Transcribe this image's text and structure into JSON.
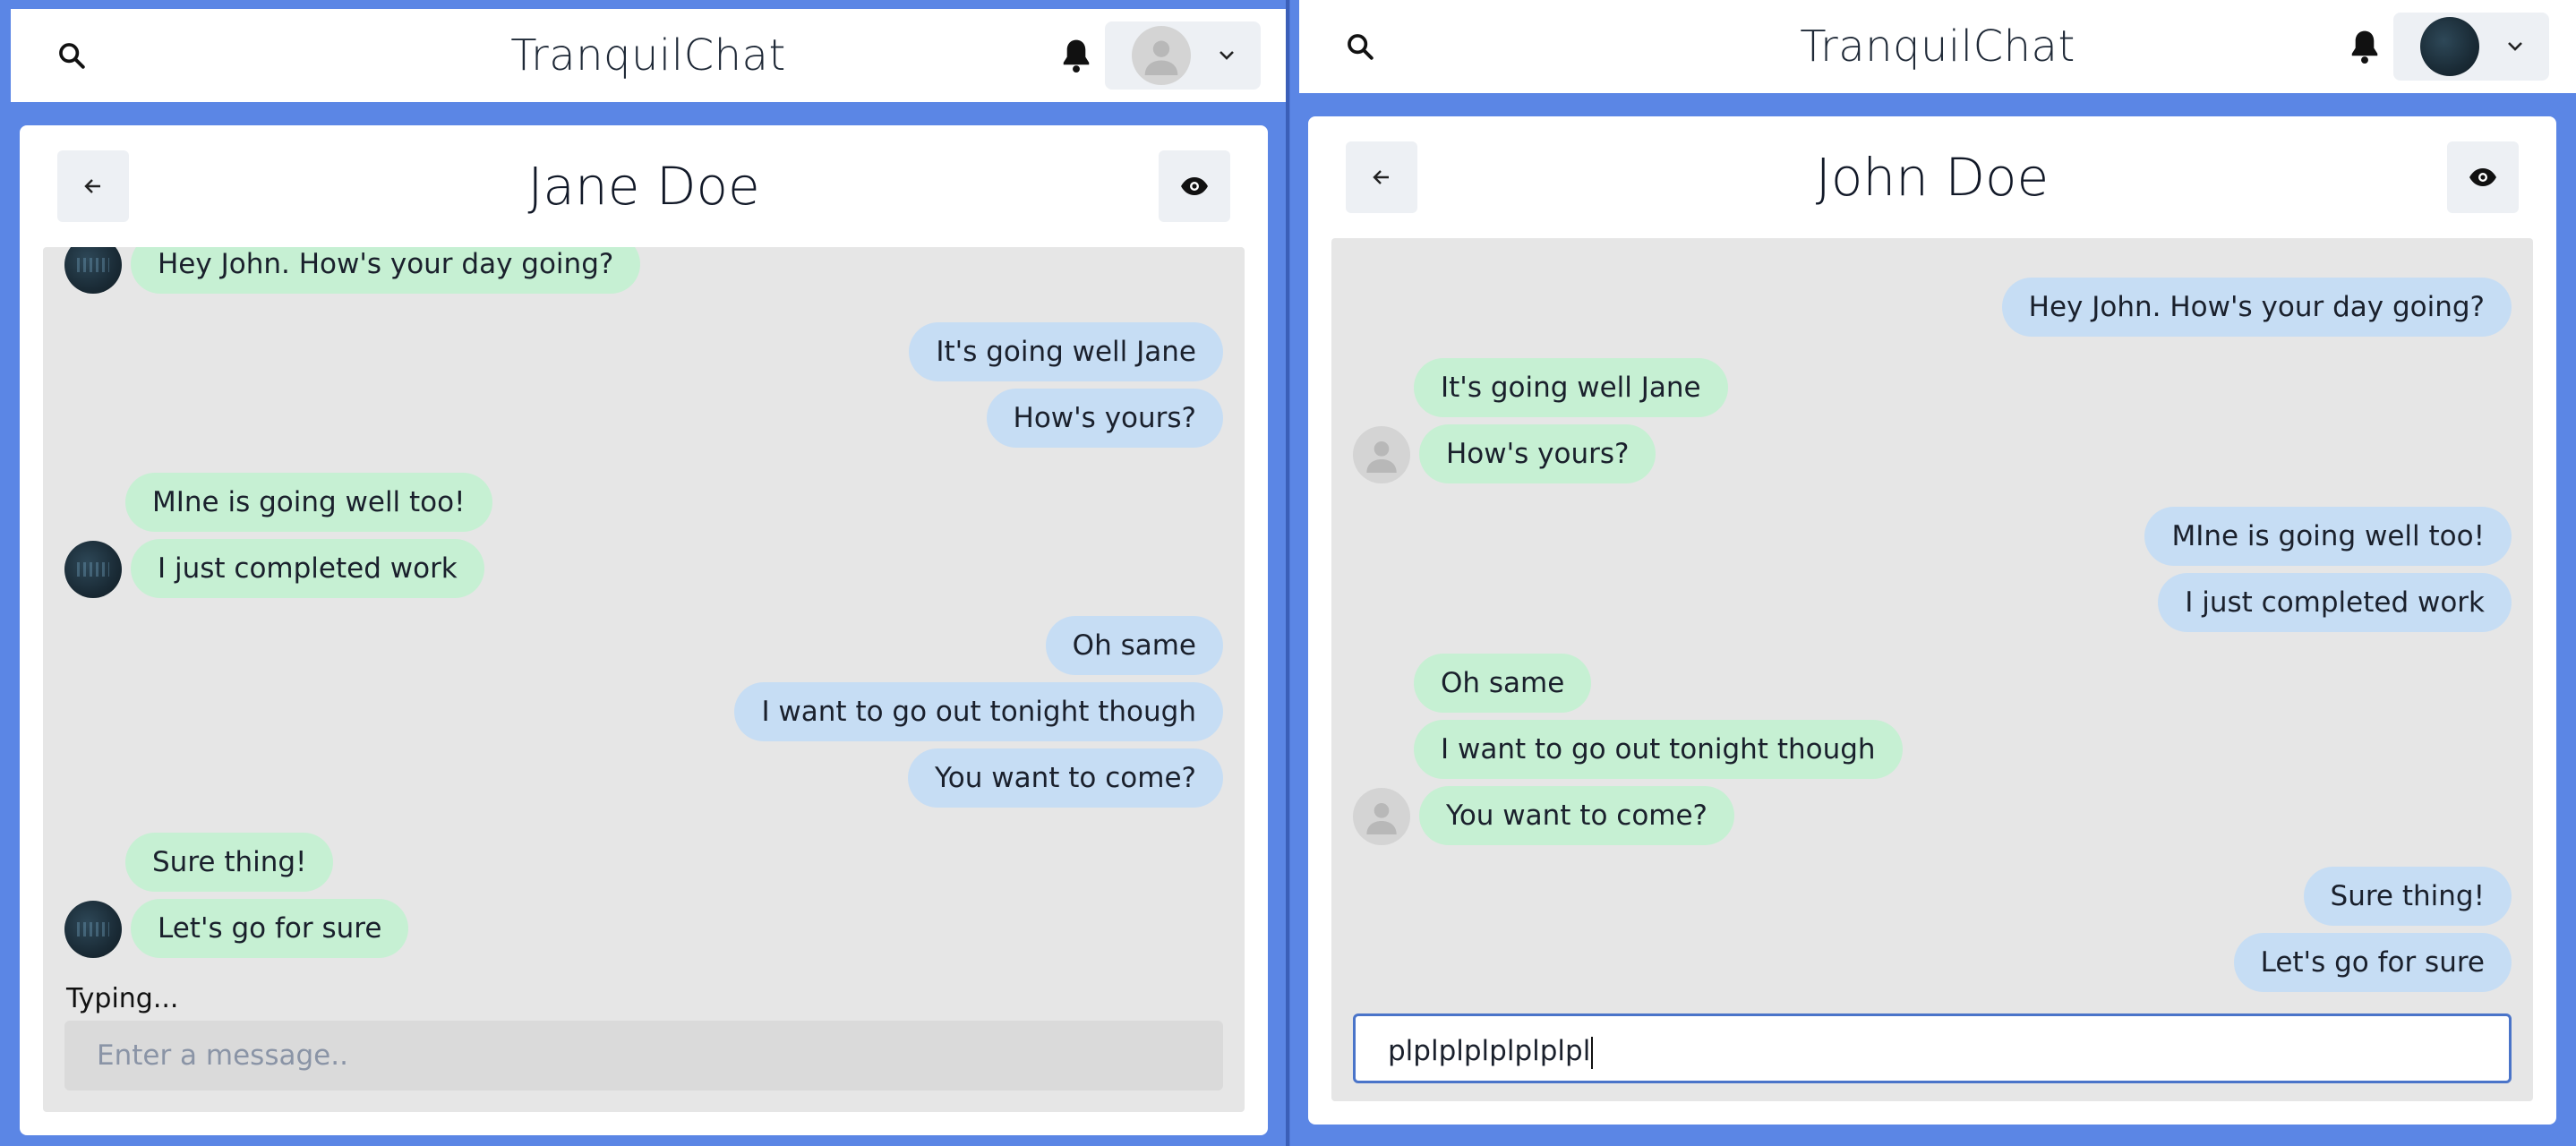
{
  "left": {
    "app_title": "TranquilChat",
    "chat_name": "Jane Doe",
    "typing": "Typing...",
    "input_placeholder": "Enter a message..",
    "messages": [
      "Hey John. How's your day going?",
      "It's going well Jane",
      "How's yours?",
      "MIne is going well too!",
      "I just completed work",
      "Oh same",
      "I want to go out tonight though",
      "You want to come?",
      "Sure thing!",
      "Let's go for sure"
    ]
  },
  "right": {
    "app_title": "TranquilChat",
    "chat_name": "John Doe",
    "input_value": "plplplplplplplpl",
    "messages": [
      "Hey John. How's your day going?",
      "It's going well Jane",
      "How's yours?",
      "MIne is going well too!",
      "I just completed work",
      "Oh same",
      "I want to go out tonight though",
      "You want to come?",
      "Sure thing!",
      "Let's go for sure"
    ]
  },
  "icons": {
    "search": "search-icon",
    "bell": "bell-icon",
    "chevron": "chevron-down-icon",
    "back": "arrow-left-icon",
    "eye": "eye-icon"
  },
  "colors": {
    "outgoing_bubble": "#c6ddf4",
    "incoming_bubble": "#c6f0d3",
    "background": "#5b86e5"
  }
}
